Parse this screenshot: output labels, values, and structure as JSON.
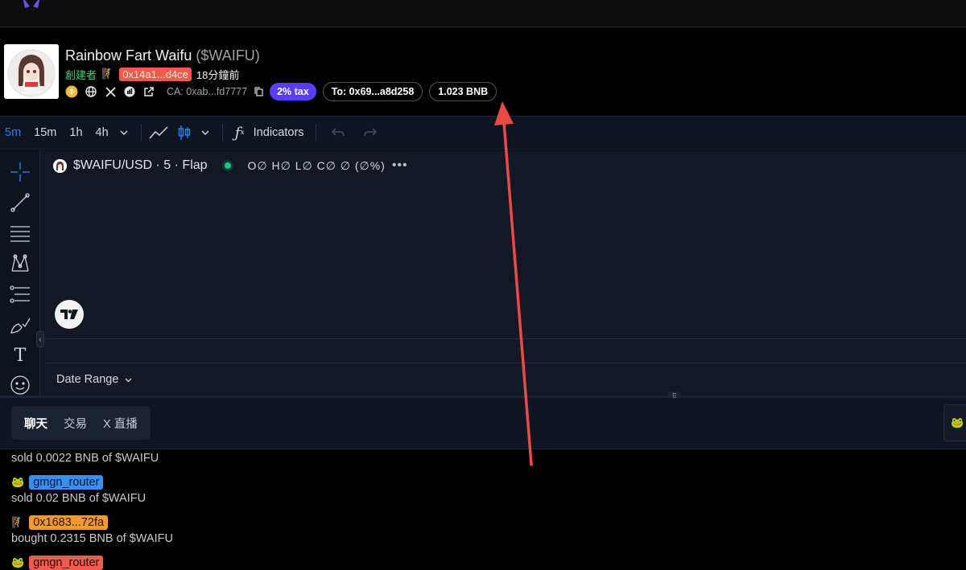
{
  "token": {
    "name": "Rainbow Fart Waifu",
    "symbol": "($WAIFU)",
    "creator_label": "創建者",
    "creator_address": "0x14a1...d4ce",
    "created_ago": "18分鐘前",
    "ca_text": "CA: 0xab...fd7777",
    "tax": "2% tax",
    "to_address": "To: 0x69...a8d258",
    "amount": "1.023 BNB"
  },
  "chart_toolbar": {
    "timeframes": [
      "5m",
      "15m",
      "1h",
      "4h"
    ],
    "active_timeframe": "5m",
    "indicators_label": "Indicators"
  },
  "chart": {
    "pair_label": "$WAIFU/USD · 5 · Flap",
    "ohlc": "O∅ H∅ L∅ C∅ ∅ (∅%)",
    "more": "•••",
    "date_range_label": "Date Range"
  },
  "tabs": [
    "聊天",
    "交易",
    "X 直播"
  ],
  "feed": [
    {
      "text": "sold 0.0022 BNB of $WAIFU"
    },
    {
      "user": "gmgn_router",
      "color": "blue",
      "text": "sold 0.02 BNB of $WAIFU"
    },
    {
      "user": "0x1683...72fa",
      "color": "orange",
      "text": "bought 0.2315 BNB of $WAIFU"
    },
    {
      "user": "gmgn_router",
      "color": "red"
    }
  ],
  "colors": {
    "accent_blue": "#2f7cf6",
    "tax_purple": "#5b3df5",
    "creator_green": "#3fd17a",
    "annotation_red": "#e84a45"
  }
}
